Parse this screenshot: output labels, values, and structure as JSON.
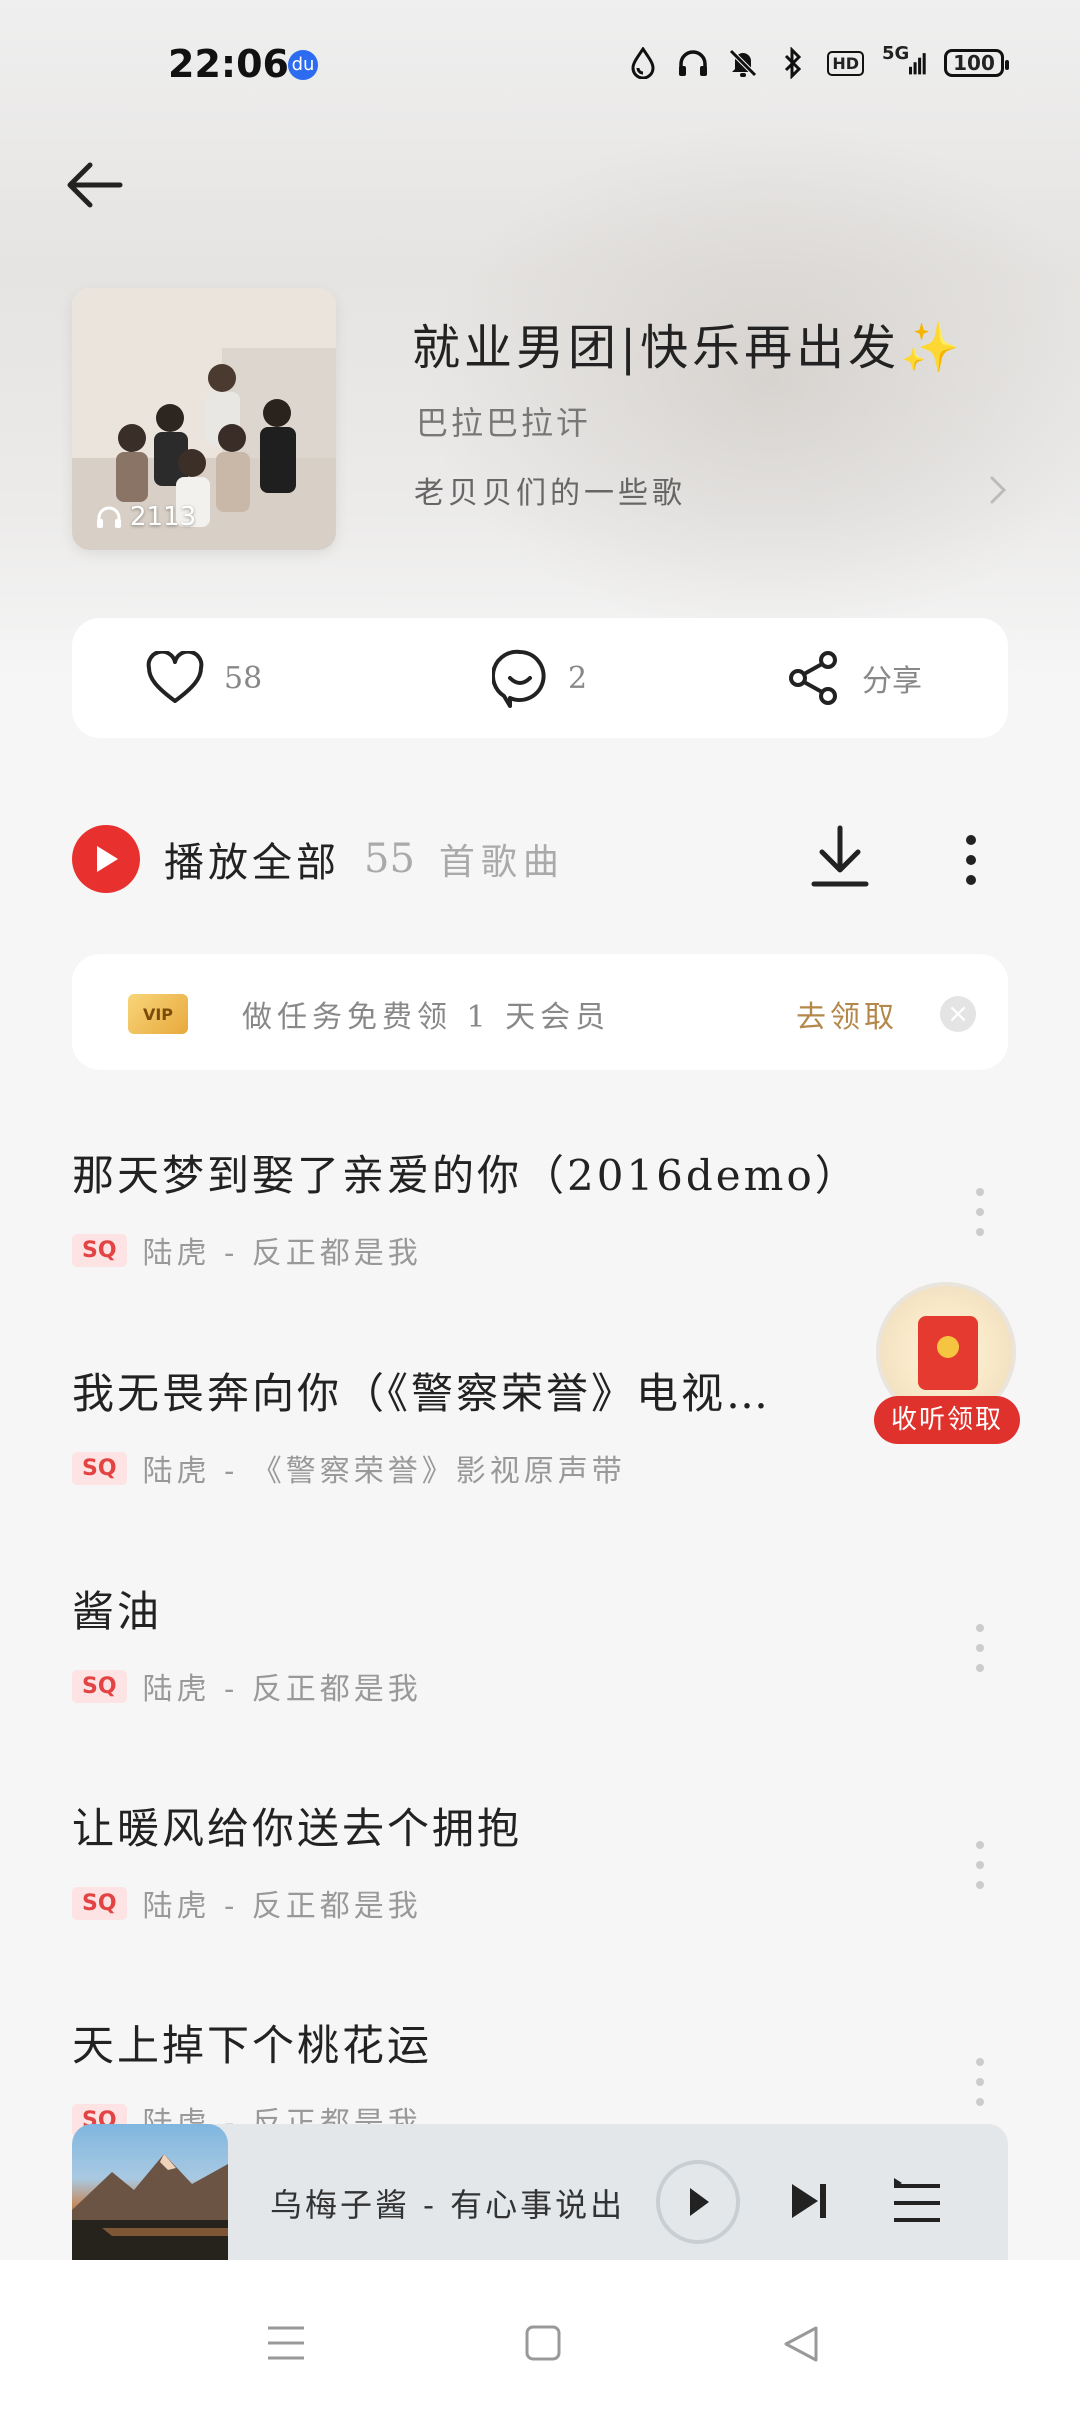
{
  "status_bar": {
    "time": "22:06",
    "baidu_label": "du",
    "hd_label": "HD",
    "signal_label": "5G",
    "battery": "100",
    "icons": [
      "droplet-icon",
      "headphones-icon",
      "bell-off-icon",
      "bluetooth-icon",
      "hd-icon",
      "signal-5g-icon",
      "battery-icon"
    ]
  },
  "playlist": {
    "title": "就业男团|快乐再出发✨",
    "author": "巴拉巴拉讦",
    "description": "老贝贝们的一些歌",
    "play_count": "2113"
  },
  "actions": {
    "likes": "58",
    "comments": "2",
    "share_label": "分享"
  },
  "play_all": {
    "label": "播放全部",
    "count": "55",
    "count_label": "首歌曲"
  },
  "vip_banner": {
    "badge": "VIP",
    "text": "做任务免费领 1 天会员",
    "action": "去领取",
    "close": "×"
  },
  "songs": [
    {
      "name": "那天梦到娶了亲爱的你（2016demo）",
      "quality": "SQ",
      "artist": "陆虎 - 反正都是我"
    },
    {
      "name": "我无畏奔向你（《警察荣誉》电视…",
      "quality": "SQ",
      "artist": "陆虎 - 《警察荣誉》影视原声带"
    },
    {
      "name": "酱油",
      "quality": "SQ",
      "artist": "陆虎 - 反正都是我"
    },
    {
      "name": "让暖风给你送去个拥抱",
      "quality": "SQ",
      "artist": "陆虎 - 反正都是我"
    },
    {
      "name": "天上掉下个桃花运",
      "quality": "SQ",
      "artist": "陆虎 - 反正都是我"
    }
  ],
  "red_packet": {
    "label": "收听领取"
  },
  "mini_player": {
    "now_playing": "乌梅子酱 - 有心事说出"
  },
  "colors": {
    "accent_red": "#e8312f",
    "vip_gold": "#b4884a"
  }
}
